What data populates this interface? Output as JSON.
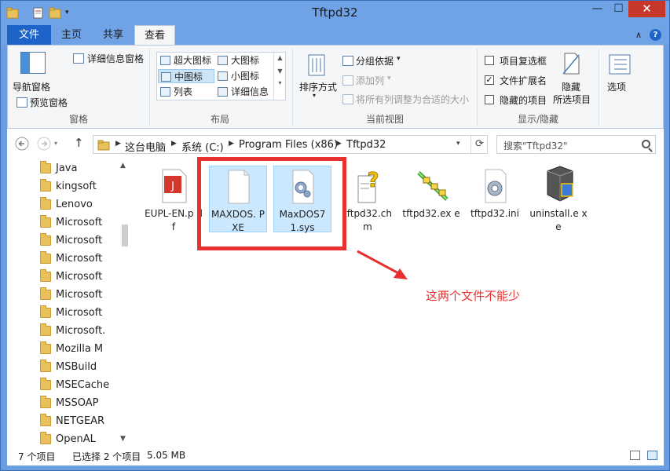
{
  "window": {
    "title": "Tftpd32",
    "minimize": "—",
    "maximize": "☐",
    "close": "✕"
  },
  "tabs": {
    "file": "文件",
    "home": "主页",
    "share": "共享",
    "view": "查看"
  },
  "ribbon": {
    "pane": {
      "nav_pane": "导航窗格",
      "preview_pane": "预览窗格",
      "details_pane": "详细信息窗格",
      "group_label": "窗格"
    },
    "layout": {
      "items": [
        "超大图标",
        "大图标",
        "中图标",
        "小图标",
        "列表",
        "详细信息"
      ],
      "selected": "中图标",
      "group_label": "布局"
    },
    "current_view": {
      "sort_by": "排序方式",
      "group_by": "分组依据",
      "add_column": "添加列",
      "size_all_columns": "将所有列调整为合适的大小",
      "group_label": "当前视图"
    },
    "show_hide": {
      "item_checkboxes": "项目复选框",
      "file_extensions": "文件扩展名",
      "hidden_items": "隐藏的项目",
      "hide_selected_1": "隐藏",
      "hide_selected_2": "所选项目",
      "group_label": "显示/隐藏",
      "checked": {
        "item_checkboxes": false,
        "file_extensions": true,
        "hidden_items": false
      }
    },
    "options": "选项"
  },
  "address": {
    "crumbs": [
      "这台电脑",
      "系统 (C:)",
      "Program Files (x86)",
      "Tftpd32"
    ],
    "search_placeholder": "搜索\"Tftpd32\""
  },
  "tree": {
    "items": [
      "Java",
      "kingsoft",
      "Lenovo",
      "Microsoft",
      "Microsoft",
      "Microsoft",
      "Microsoft",
      "Microsoft",
      "Microsoft",
      "Microsoft.",
      "Mozilla M",
      "MSBuild",
      "MSECache",
      "MSSOAP",
      "NETGEAR",
      "OpenAL"
    ]
  },
  "files": [
    {
      "name": "EUPL-EN.pdf",
      "label": "EUPL-EN.p df",
      "icon": "pdf-icon",
      "selected": false
    },
    {
      "name": "MAXDOS.PXE",
      "label": "MAXDOS. PXE",
      "icon": "blank-file-icon",
      "selected": true
    },
    {
      "name": "MaxDOS71.sys",
      "label": "MaxDOS7 1.sys",
      "icon": "system-file-icon",
      "selected": true
    },
    {
      "name": "tftpd32.chm",
      "label": "tftpd32.ch m",
      "icon": "help-file-icon",
      "selected": false
    },
    {
      "name": "tftpd32.exe",
      "label": "tftpd32.ex e",
      "icon": "tftp-app-icon",
      "selected": false
    },
    {
      "name": "tftpd32.ini",
      "label": "tftpd32.ini",
      "icon": "settings-file-icon",
      "selected": false
    },
    {
      "name": "uninstall.exe",
      "label": "uninstall.e xe",
      "icon": "uninstaller-icon",
      "selected": false
    }
  ],
  "annotation": "这两个文件不能少",
  "status": {
    "item_count": "7 个项目",
    "selected": "已选择 2 个项目",
    "size": "5.05 MB"
  },
  "colors": {
    "accent": "#1e64c8",
    "annotation_red": "#e8312f",
    "selection": "#cce8ff"
  }
}
